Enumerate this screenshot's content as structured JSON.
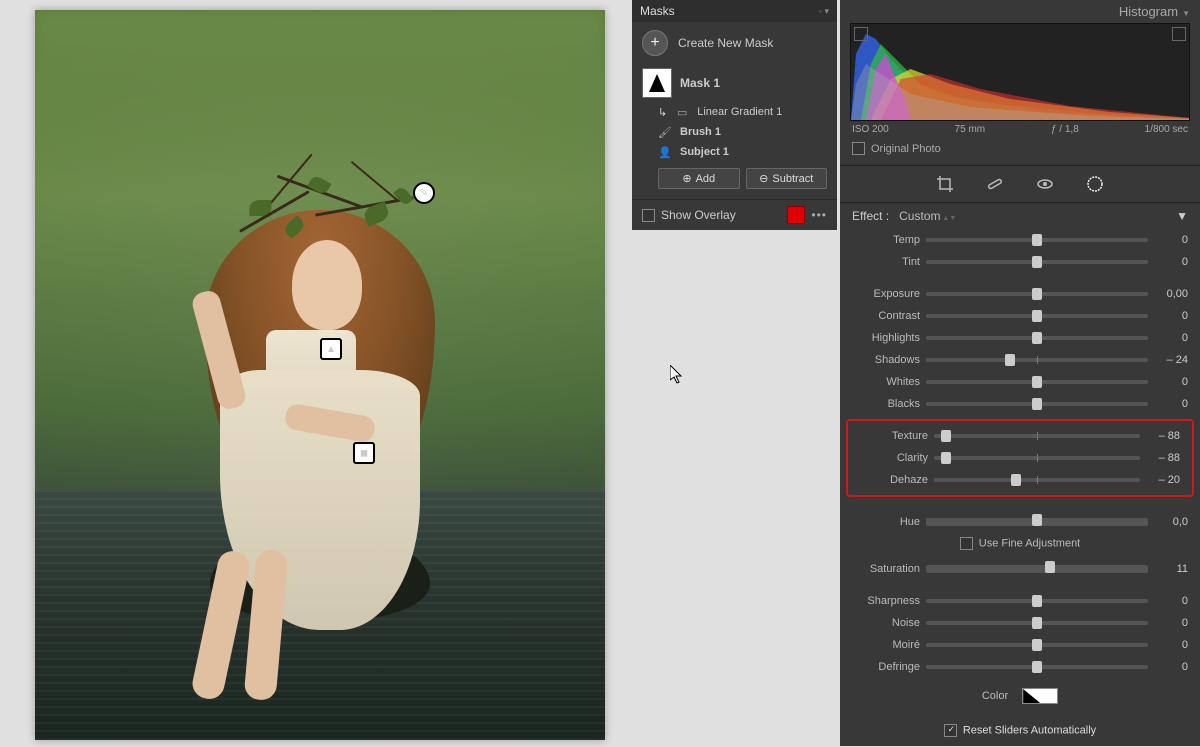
{
  "masks_panel": {
    "title": "Masks",
    "create_label": "Create New Mask",
    "mask_name": "Mask 1",
    "components": [
      {
        "icon": "gradient",
        "label": "Linear Gradient 1"
      },
      {
        "icon": "brush",
        "label": "Brush 1"
      },
      {
        "icon": "subject",
        "label": "Subject 1"
      }
    ],
    "add_label": "Add",
    "subtract_label": "Subtract",
    "show_overlay_label": "Show Overlay"
  },
  "histogram": {
    "title": "Histogram",
    "iso": "ISO 200",
    "focal": "75 mm",
    "aperture": "ƒ / 1,8",
    "shutter": "1/800 sec",
    "original_label": "Original Photo"
  },
  "effect": {
    "label": "Effect :",
    "value": "Custom"
  },
  "sliders_a": [
    {
      "name": "Temp",
      "value": "0",
      "pos": 50
    },
    {
      "name": "Tint",
      "value": "0",
      "pos": 50
    }
  ],
  "sliders_b": [
    {
      "name": "Exposure",
      "value": "0,00",
      "pos": 50
    },
    {
      "name": "Contrast",
      "value": "0",
      "pos": 50
    },
    {
      "name": "Highlights",
      "value": "0",
      "pos": 50
    },
    {
      "name": "Shadows",
      "value": "– 24",
      "pos": 38
    },
    {
      "name": "Whites",
      "value": "0",
      "pos": 50
    },
    {
      "name": "Blacks",
      "value": "0",
      "pos": 50
    }
  ],
  "sliders_hl": [
    {
      "name": "Texture",
      "value": "– 88",
      "pos": 6
    },
    {
      "name": "Clarity",
      "value": "– 88",
      "pos": 6
    },
    {
      "name": "Dehaze",
      "value": "– 20",
      "pos": 40
    }
  ],
  "hue": {
    "name": "Hue",
    "value": "0,0",
    "pos": 50
  },
  "use_fine_label": "Use Fine Adjustment",
  "saturation": {
    "name": "Saturation",
    "value": "11",
    "pos": 56
  },
  "sliders_c": [
    {
      "name": "Sharpness",
      "value": "0",
      "pos": 50
    },
    {
      "name": "Noise",
      "value": "0",
      "pos": 50
    },
    {
      "name": "Moiré",
      "value": "0",
      "pos": 50
    },
    {
      "name": "Defringe",
      "value": "0",
      "pos": 50
    }
  ],
  "color_label": "Color",
  "reset_label": "Reset Sliders Automatically"
}
